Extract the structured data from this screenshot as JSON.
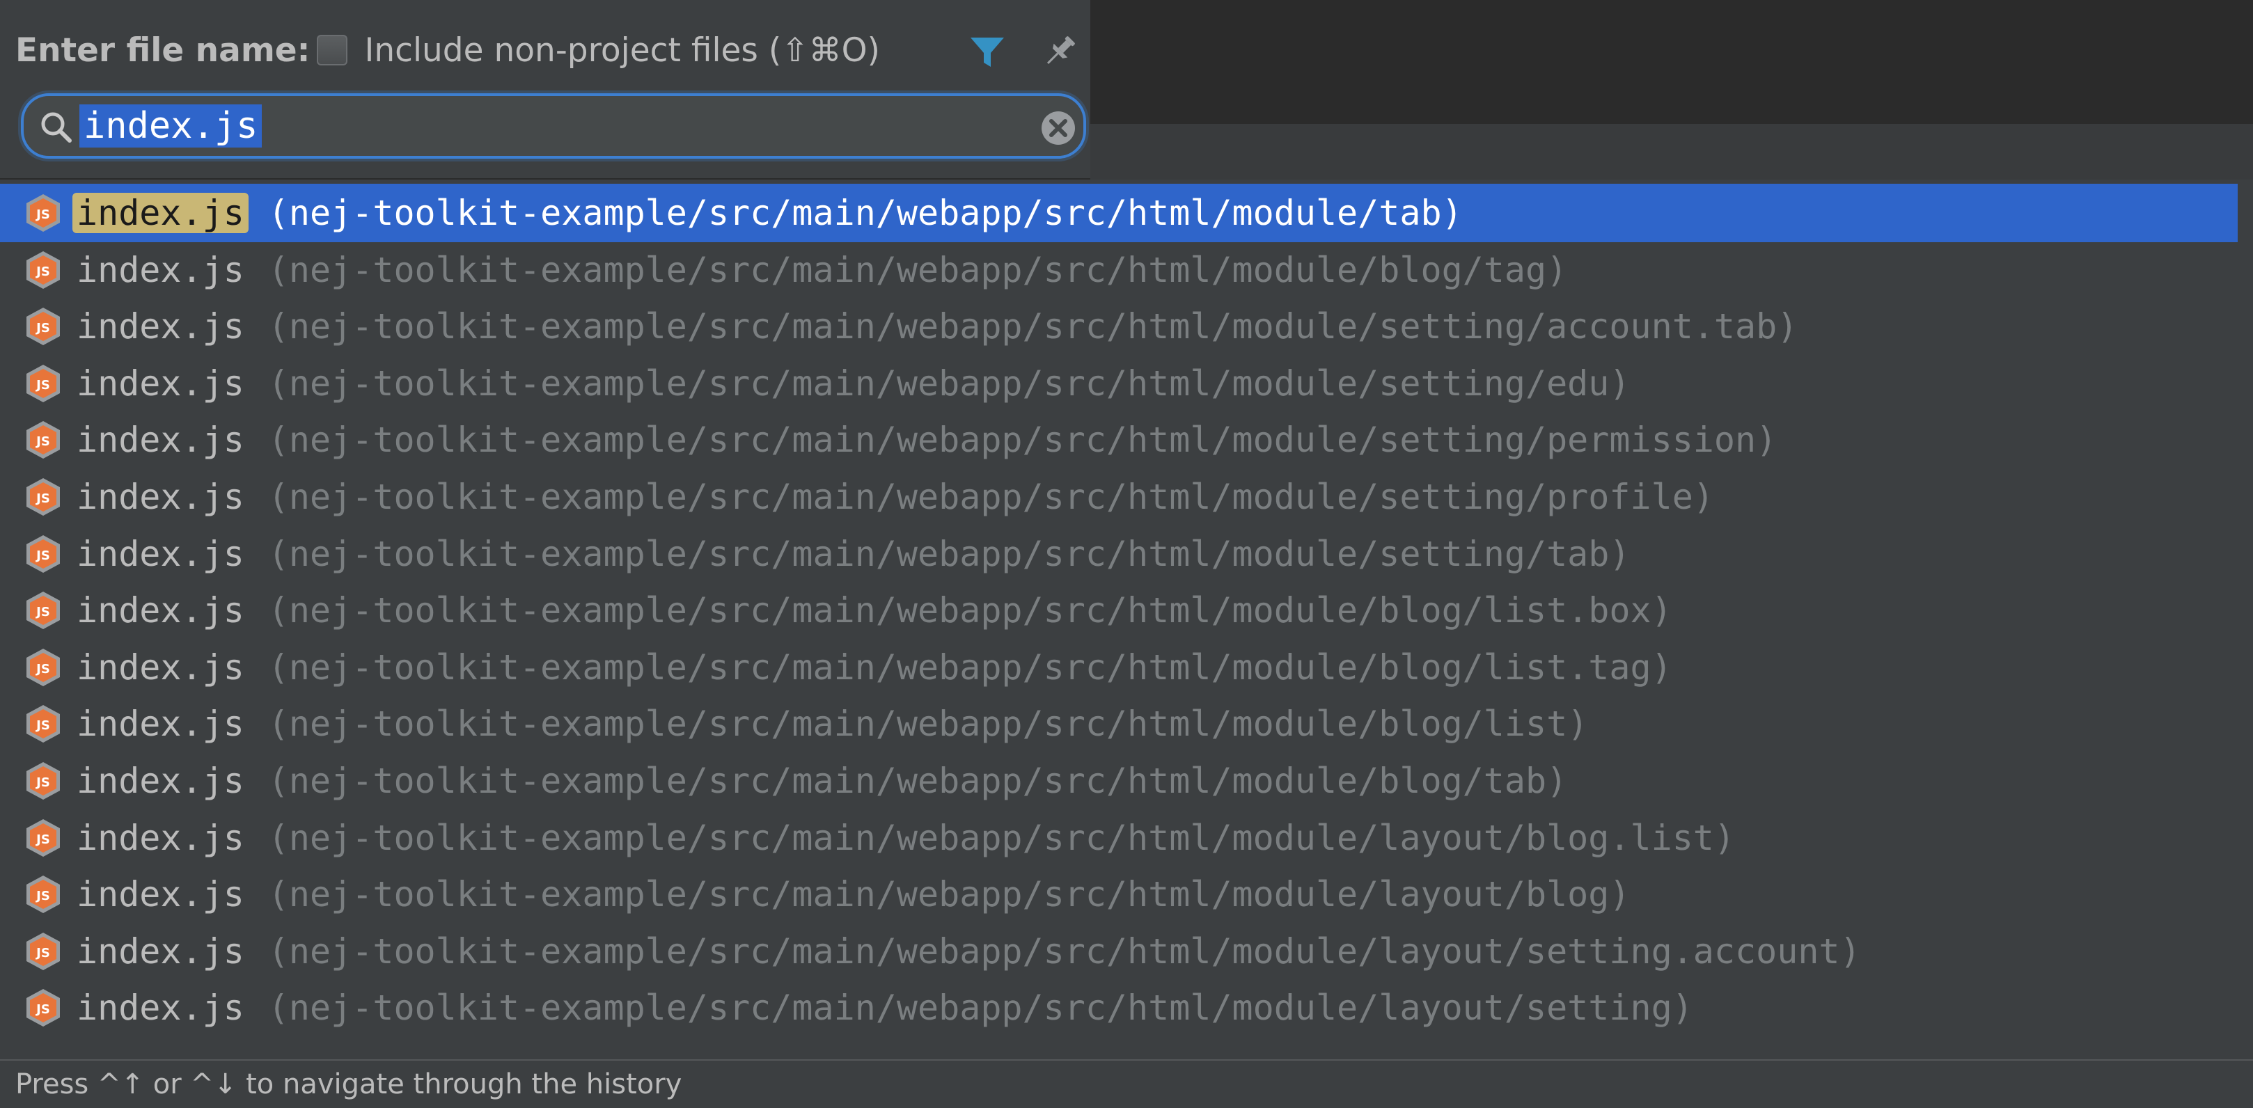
{
  "header": {
    "prompt_label": "Enter file name:",
    "checkbox_label": "Include non-project files (⇧⌘O)",
    "checkbox_checked": false,
    "filter_icon": "filter-icon",
    "pin_icon": "pin-icon"
  },
  "search": {
    "value": "index.js",
    "icon": "search-icon",
    "clear_icon": "clear-icon"
  },
  "colors": {
    "selection": "#2f65ca",
    "match_highlight": "#c9b775",
    "search_border": "#3d7fd1",
    "panel_bg": "#3c3f41",
    "js_icon": "#e8753a"
  },
  "results": [
    {
      "name": "index.js",
      "path": "(nej-toolkit-example/src/main/webapp/src/html/module/tab)",
      "selected": true
    },
    {
      "name": "index.js",
      "path": "(nej-toolkit-example/src/main/webapp/src/html/module/blog/tag)"
    },
    {
      "name": "index.js",
      "path": "(nej-toolkit-example/src/main/webapp/src/html/module/setting/account.tab)"
    },
    {
      "name": "index.js",
      "path": "(nej-toolkit-example/src/main/webapp/src/html/module/setting/edu)"
    },
    {
      "name": "index.js",
      "path": "(nej-toolkit-example/src/main/webapp/src/html/module/setting/permission)"
    },
    {
      "name": "index.js",
      "path": "(nej-toolkit-example/src/main/webapp/src/html/module/setting/profile)"
    },
    {
      "name": "index.js",
      "path": "(nej-toolkit-example/src/main/webapp/src/html/module/setting/tab)"
    },
    {
      "name": "index.js",
      "path": "(nej-toolkit-example/src/main/webapp/src/html/module/blog/list.box)"
    },
    {
      "name": "index.js",
      "path": "(nej-toolkit-example/src/main/webapp/src/html/module/blog/list.tag)"
    },
    {
      "name": "index.js",
      "path": "(nej-toolkit-example/src/main/webapp/src/html/module/blog/list)"
    },
    {
      "name": "index.js",
      "path": "(nej-toolkit-example/src/main/webapp/src/html/module/blog/tab)"
    },
    {
      "name": "index.js",
      "path": "(nej-toolkit-example/src/main/webapp/src/html/module/layout/blog.list)"
    },
    {
      "name": "index.js",
      "path": "(nej-toolkit-example/src/main/webapp/src/html/module/layout/blog)"
    },
    {
      "name": "index.js",
      "path": "(nej-toolkit-example/src/main/webapp/src/html/module/layout/setting.account)"
    },
    {
      "name": "index.js",
      "path": "(nej-toolkit-example/src/main/webapp/src/html/module/layout/setting)"
    }
  ],
  "footer": {
    "hint": "Press ^↑ or ^↓ to navigate through the history"
  }
}
